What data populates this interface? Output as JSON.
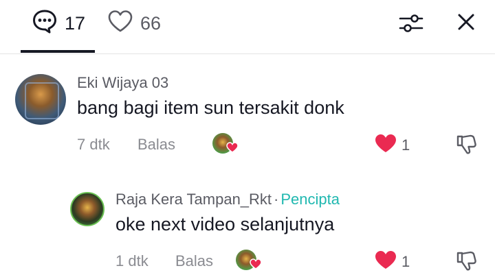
{
  "header": {
    "comments_count": "17",
    "likes_count": "66"
  },
  "comments": [
    {
      "username": "Eki Wijaya 03",
      "text": "bang bagi item sun tersakit donk",
      "time": "7 dtk",
      "reply_label": "Balas",
      "likes": "1"
    },
    {
      "username": "Raja Kera Tampan_Rkt",
      "separator": "·",
      "badge": "Pencipta",
      "text": "oke next video selanjutnya",
      "time": "1 dtk",
      "reply_label": "Balas",
      "likes": "1"
    }
  ],
  "colors": {
    "like_red": "#ea2a51",
    "creator_teal": "#20b8b0",
    "text_dark": "#161823",
    "text_muted": "#8a8b91"
  }
}
